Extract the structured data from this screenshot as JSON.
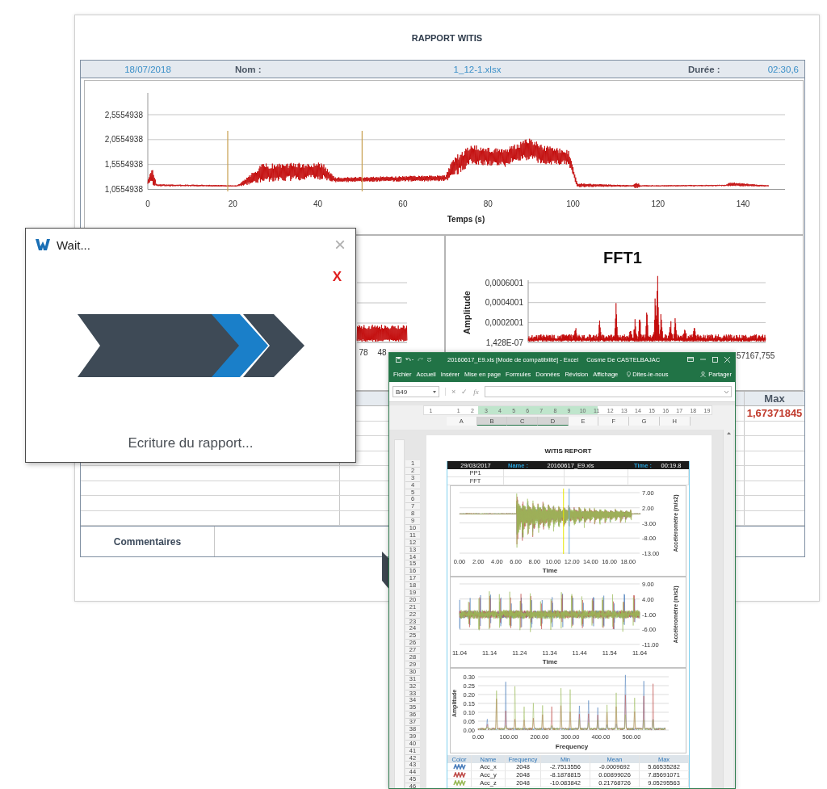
{
  "report_window": {
    "title": "RAPPORT WITIS",
    "header": {
      "date": "18/07/2018",
      "name_label": "Nom :",
      "file_name": "1_12-1.xlsx",
      "duration_label": "Durée :",
      "duration": "02:30,6"
    },
    "signal_chart": {
      "yticks": [
        "2,5554938",
        "2,0554938",
        "1,5554938",
        "1,0554938"
      ],
      "xticks": [
        "0",
        "20",
        "40",
        "60",
        "80",
        "100",
        "120",
        "140"
      ],
      "xlabel": "Temps (s)"
    },
    "left_chart": {
      "xticks": [
        "78",
        "48"
      ]
    },
    "fft_chart": {
      "title": "FFT1",
      "ylabel": "Amplitude",
      "yticks": [
        "0,0006001",
        "0,0004001",
        "0,0002001",
        "1,428E-07"
      ],
      "xtick": "57167,755"
    },
    "stats_table": {
      "column": "Max",
      "value": "1,67371845"
    },
    "comments_label": "Commentaires"
  },
  "wait_dialog": {
    "title": "Wait...",
    "close": "×",
    "cancel": "X",
    "message": "Ecriture du rapport..."
  },
  "excel_window": {
    "title": "20160617_E9.xls [Mode de compatibilité] - Excel",
    "user": "Cosme De CASTELBAJAC",
    "ribbon_tabs": [
      "Fichier",
      "Accueil",
      "Insérer",
      "Mise en page",
      "Formules",
      "Données",
      "Révision",
      "Affichage"
    ],
    "tell_me": "Dites-le-nous",
    "share": "Partager",
    "name_box": "B49",
    "cancel": "×",
    "enter": "✓",
    "function": "fx",
    "ruler": [
      "1",
      "1",
      "2",
      "3",
      "4",
      "5",
      "6",
      "7",
      "8",
      "9",
      "10",
      "11",
      "12",
      "13",
      "14",
      "15",
      "16",
      "17",
      "18",
      "19"
    ],
    "columns": [
      {
        "label": "A",
        "selected": false
      },
      {
        "label": "B",
        "selected": true
      },
      {
        "label": "C",
        "selected": true
      },
      {
        "label": "D",
        "selected": true
      },
      {
        "label": "E",
        "selected": false
      },
      {
        "label": "F",
        "selected": false
      },
      {
        "label": "G",
        "selected": false
      },
      {
        "label": "H",
        "selected": false
      }
    ],
    "row_numbers": [
      "1",
      "2",
      "3",
      "4",
      "5",
      "6",
      "7",
      "8",
      "9",
      "10",
      "11",
      "12",
      "13",
      "14",
      "15",
      "16",
      "17",
      "18",
      "19",
      "20",
      "21",
      "22",
      "23",
      "24",
      "25",
      "26",
      "27",
      "28",
      "29",
      "30",
      "31",
      "32",
      "33",
      "34",
      "35",
      "36",
      "37",
      "38",
      "39",
      "40",
      "41",
      "42",
      "43",
      "44",
      "45",
      "46"
    ],
    "report": {
      "title": "WITIS REPORT",
      "header": {
        "date": "29/03/2017",
        "name_label": "Name :",
        "file_name": "20160617_E9.xls",
        "time_label": "Time :",
        "time": "00:19.8"
      },
      "rows": [
        "PP1",
        "FFT"
      ],
      "charts": [
        {
          "kind": "time",
          "yticks": [
            "7.00",
            "2.00",
            "-3.00",
            "-8.00",
            "-13.00"
          ],
          "xticks": [
            "0.00",
            "2.00",
            "4.00",
            "6.00",
            "8.00",
            "10.00",
            "12.00",
            "14.00",
            "16.00",
            "18.00"
          ],
          "xlabel": "Time",
          "ylabel": "Accéléromètre (m/s2)"
        },
        {
          "kind": "zoom",
          "yticks": [
            "9.00",
            "4.00",
            "-1.00",
            "-6.00",
            "-11.00"
          ],
          "xticks": [
            "11.04",
            "11.14",
            "11.24",
            "11.34",
            "11.44",
            "11.54",
            "11.64"
          ],
          "xlabel": "Time",
          "ylabel": "Accéléromètre (m/s2)"
        },
        {
          "kind": "spectrum",
          "yticks": [
            "0.30",
            "0.25",
            "0.20",
            "0.15",
            "0.10",
            "0.05",
            "0.00"
          ],
          "xticks": [
            "0.00",
            "100.00",
            "200.00",
            "300.00",
            "400.00",
            "500.00"
          ],
          "xlabel": "Frequency",
          "ylabel": "Amplitude"
        }
      ],
      "table": {
        "columns": [
          "Color",
          "Name",
          "Frequency",
          "Min",
          "Mean",
          "Max"
        ],
        "rows": [
          {
            "color": "#4f81bd",
            "name": "Acc_x",
            "frequency": "2048",
            "min": "-2.7513556",
            "mean": "-0.0009692",
            "max": "5.66535282"
          },
          {
            "color": "#c0504d",
            "name": "Acc_y",
            "frequency": "2048",
            "min": "-8.1878815",
            "mean": "0.00899026",
            "max": "7.85691071"
          },
          {
            "color": "#9bbb59",
            "name": "Acc_z",
            "frequency": "2048",
            "min": "-10.083842",
            "mean": "0.21768726",
            "max": "9.05295563"
          }
        ]
      }
    }
  }
}
